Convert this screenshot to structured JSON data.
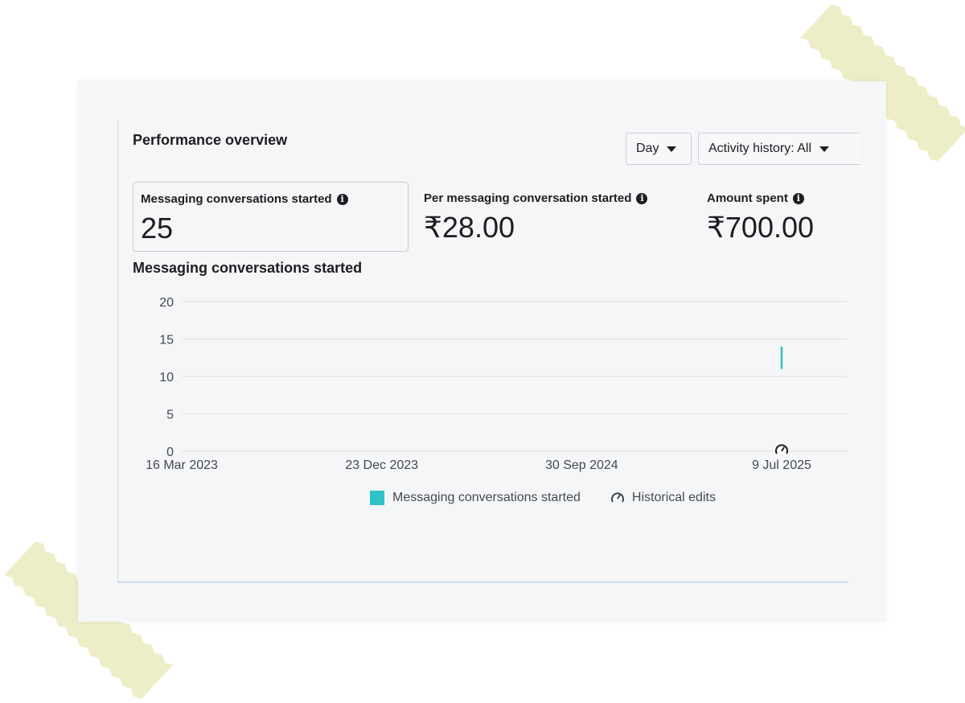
{
  "panel": {
    "title": "Performance overview",
    "day_button": "Day",
    "activity_button": "Activity history: All"
  },
  "metrics": [
    {
      "label": "Messaging conversations started",
      "value": "25"
    },
    {
      "label": "Per messaging conversation started",
      "value": "₹28.00"
    },
    {
      "label": "Amount spent",
      "value": "₹700.00"
    }
  ],
  "colors": {
    "series": "#2fc2c4",
    "grid": "#dddfe2"
  },
  "legend": {
    "series_label": "Messaging conversations started",
    "historical_label": "Historical edits"
  },
  "chart_data": {
    "type": "line",
    "title": "Messaging conversations started",
    "ylim": [
      0,
      20
    ],
    "yticks": [
      0,
      5,
      10,
      15,
      20
    ],
    "xlim": [
      "2023-03-16",
      "2025-10-10"
    ],
    "xticks": [
      "16 Mar 2023",
      "23 Dec 2023",
      "30 Sep 2024",
      "9 Jul 2025"
    ],
    "grid": true,
    "legend_position": "bottom",
    "series": [
      {
        "name": "Messaging conversations started",
        "x": [
          "2025-07-09",
          "2025-07-09"
        ],
        "y": [
          11,
          14
        ]
      }
    ],
    "historical_edits": [
      "2025-07-09"
    ]
  }
}
